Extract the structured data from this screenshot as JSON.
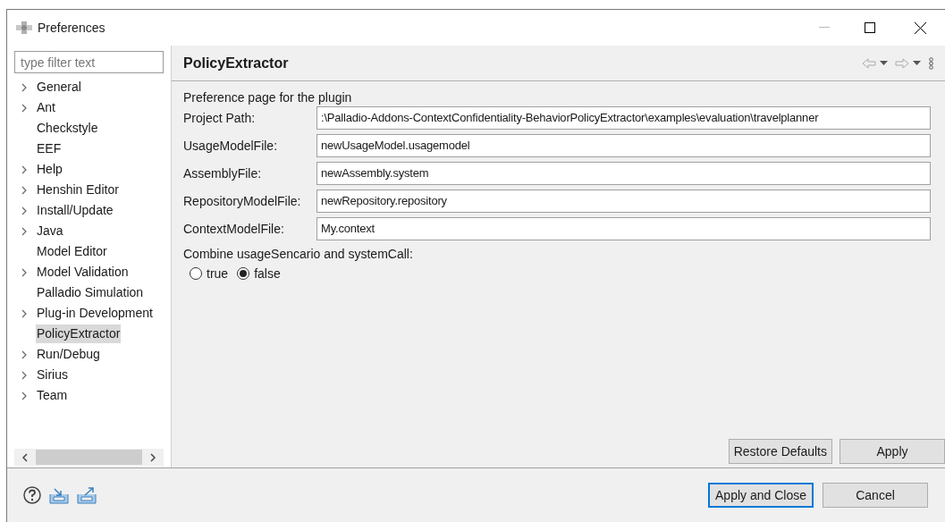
{
  "window": {
    "title": "Preferences"
  },
  "filter": {
    "placeholder": "type filter text"
  },
  "tree": [
    {
      "label": "General",
      "expandable": true,
      "selected": false
    },
    {
      "label": "Ant",
      "expandable": true,
      "selected": false
    },
    {
      "label": "Checkstyle",
      "expandable": false,
      "selected": false
    },
    {
      "label": "EEF",
      "expandable": false,
      "selected": false
    },
    {
      "label": "Help",
      "expandable": true,
      "selected": false
    },
    {
      "label": "Henshin Editor",
      "expandable": true,
      "selected": false
    },
    {
      "label": "Install/Update",
      "expandable": true,
      "selected": false
    },
    {
      "label": "Java",
      "expandable": true,
      "selected": false
    },
    {
      "label": "Model Editor",
      "expandable": false,
      "selected": false
    },
    {
      "label": "Model Validation",
      "expandable": true,
      "selected": false
    },
    {
      "label": "Palladio Simulation",
      "expandable": false,
      "selected": false
    },
    {
      "label": "Plug-in Development",
      "expandable": true,
      "selected": false
    },
    {
      "label": "PolicyExtractor",
      "expandable": false,
      "selected": true
    },
    {
      "label": "Run/Debug",
      "expandable": true,
      "selected": false
    },
    {
      "label": "Sirius",
      "expandable": true,
      "selected": false
    },
    {
      "label": "Team",
      "expandable": true,
      "selected": false
    }
  ],
  "page": {
    "title": "PolicyExtractor",
    "description": "Preference page for the plugin",
    "fields": [
      {
        "label": "Project Path:",
        "value": ":\\Palladio-Addons-ContextConfidentiality-BehaviorPolicyExtractor\\examples\\evaluation\\travelplanner"
      },
      {
        "label": "UsageModelFile:",
        "value": "newUsageModel.usagemodel"
      },
      {
        "label": "AssemblyFile:",
        "value": "newAssembly.system"
      },
      {
        "label": "RepositoryModelFile:",
        "value": "newRepository.repository"
      },
      {
        "label": "ContextModelFile:",
        "value": "My.context"
      }
    ],
    "combine": {
      "label": "Combine usageSencario and systemCall:",
      "options": [
        {
          "label": "true",
          "selected": false
        },
        {
          "label": "false",
          "selected": true
        }
      ]
    },
    "buttons": [
      "Restore Defaults",
      "Apply"
    ]
  },
  "footer": {
    "buttons": [
      {
        "label": "Apply and Close",
        "default": true
      },
      {
        "label": "Cancel",
        "default": false
      }
    ]
  }
}
